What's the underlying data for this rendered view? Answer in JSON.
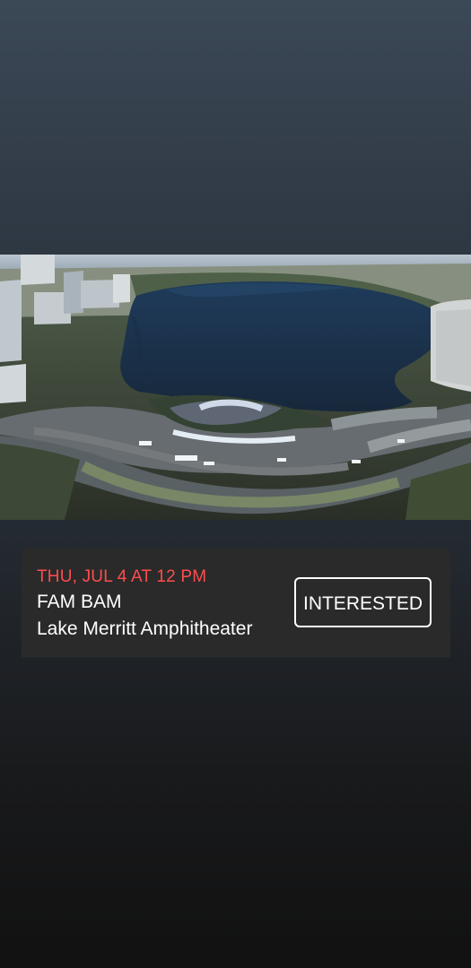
{
  "event": {
    "date": "THU, JUL 4 AT 12 PM",
    "title": "FAM BAM",
    "location": "Lake Merritt Amphitheater"
  },
  "actions": {
    "interested_label": "INTERESTED"
  },
  "colors": {
    "date": "#ff4d4d",
    "card_background": "#2a2a2a",
    "text": "#ffffff"
  }
}
